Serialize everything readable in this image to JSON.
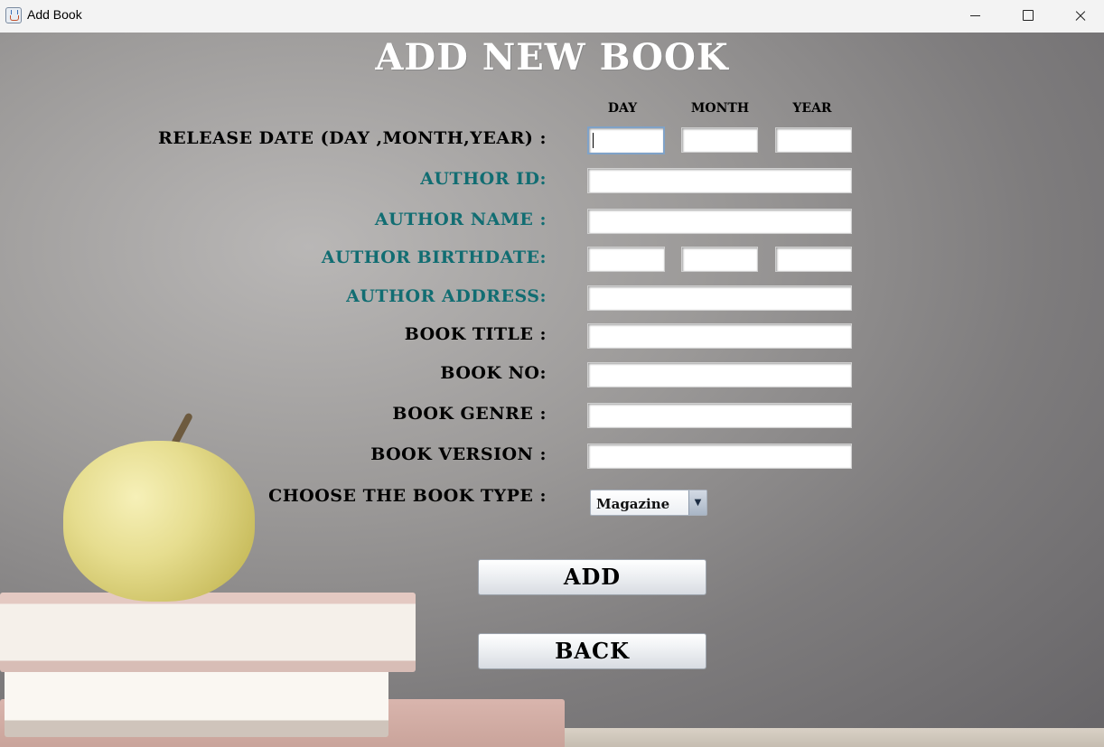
{
  "window": {
    "title": "Add Book"
  },
  "form": {
    "heading": "ADD NEW BOOK",
    "columns": {
      "day": "DAY",
      "month": "MONTH",
      "year": "YEAR"
    },
    "labels": {
      "release_date": "RELEASE DATE (DAY ,MONTH,YEAR) :",
      "author_id": "AUTHOR ID:",
      "author_name": "AUTHOR NAME :",
      "author_birthdate": "AUTHOR BIRTHDATE:",
      "author_address": "AUTHOR ADDRESS:",
      "book_title": "BOOK TITLE :",
      "book_no": "BOOK NO:",
      "book_genre": "BOOK GENRE :",
      "book_version": "BOOK VERSION :",
      "book_type": "CHOOSE THE BOOK TYPE :"
    },
    "values": {
      "release_day": "",
      "release_month": "",
      "release_year": "",
      "author_id": "",
      "author_name": "",
      "birth_day": "",
      "birth_month": "",
      "birth_year": "",
      "author_address": "",
      "book_title": "",
      "book_no": "",
      "book_genre": "",
      "book_version": ""
    },
    "book_type_selected": "Magazine",
    "buttons": {
      "add": "ADD",
      "back": "BACK"
    }
  },
  "colors": {
    "label_primary": "#000000",
    "label_author": "#116d72",
    "heading": "#ffffff"
  }
}
